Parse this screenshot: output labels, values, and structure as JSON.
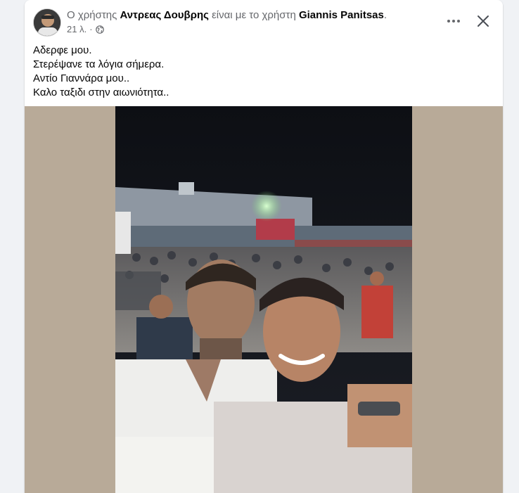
{
  "post": {
    "prefix": "Ο χρήστης ",
    "author": "Αντρεας Δουβρης",
    "middle": " είναι με το χρήστη ",
    "tagged": "Giannis Panitsas",
    "suffix": ".",
    "time": "21 λ.",
    "separator": "·",
    "privacy_icon": "globe-icon",
    "lines": [
      "Αδερφε μου.",
      "Στερέψανε τα λόγια σήμερα.",
      "Αντίο Γιαννάρα μου..",
      "Καλο ταξιδι στην αιωνιότητα.."
    ]
  },
  "controls": {
    "more_icon": "more-options-icon",
    "close_icon": "close-icon"
  },
  "colors": {
    "page_bg": "#f0f2f5",
    "card_bg": "#ffffff",
    "text_primary": "#050505",
    "text_secondary": "#65676b",
    "media_bg": "#b8aa98"
  }
}
